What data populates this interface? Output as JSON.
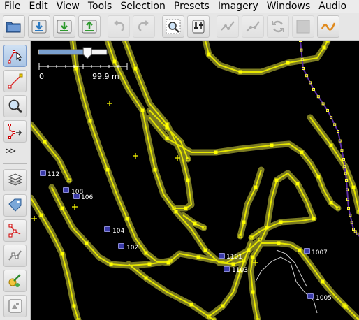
{
  "menubar": {
    "items": [
      "File",
      "Edit",
      "View",
      "Tools",
      "Selection",
      "Presets",
      "Imagery",
      "Windows",
      "Audio"
    ]
  },
  "toolbar": {
    "buttons": [
      {
        "icon": "open-folder-icon",
        "enabled": true
      },
      {
        "icon": "download-map-icon",
        "enabled": true
      },
      {
        "icon": "download-data-icon",
        "enabled": true
      },
      {
        "icon": "upload-icon",
        "enabled": true
      },
      {
        "icon": "undo-icon",
        "enabled": false
      },
      {
        "icon": "redo-icon",
        "enabled": false
      },
      {
        "icon": "zoom-to-selection-icon",
        "enabled": true
      },
      {
        "icon": "preferences-icon",
        "enabled": true
      },
      {
        "icon": "split-way-icon",
        "enabled": false
      },
      {
        "icon": "combine-way-icon",
        "enabled": false
      },
      {
        "icon": "reverse-way-icon",
        "enabled": false
      },
      {
        "icon": "area-icon",
        "enabled": false
      },
      {
        "icon": "simplify-way-icon",
        "enabled": true
      }
    ]
  },
  "sidebar": {
    "more_label": ">>",
    "tools": [
      "select-icon",
      "draw-icon",
      "zoom-icon",
      "improve-way-icon"
    ],
    "panels": [
      "layers-icon",
      "tags-icon",
      "relation-icon",
      "selection-list-icon",
      "map-paint-icon",
      "history-icon"
    ]
  },
  "scale": {
    "min_label": "0",
    "max_label": "99.9 m",
    "slider_level": 0.72
  },
  "nodes": [
    {
      "label": "112"
    },
    {
      "label": "108"
    },
    {
      "label": "106"
    },
    {
      "label": "104"
    },
    {
      "label": "102"
    },
    {
      "label": "1101"
    },
    {
      "label": "1103"
    },
    {
      "label": "1007"
    },
    {
      "label": "1005"
    }
  ],
  "colors": {
    "map_background": "#000000",
    "way_highlight": "#7a7a22",
    "way_line": "#e6e600",
    "vertex": "#ffff00",
    "relation_line": "#5b2da0",
    "relation_vertex": "#ffff33",
    "track_line": "#cfcfcf"
  }
}
